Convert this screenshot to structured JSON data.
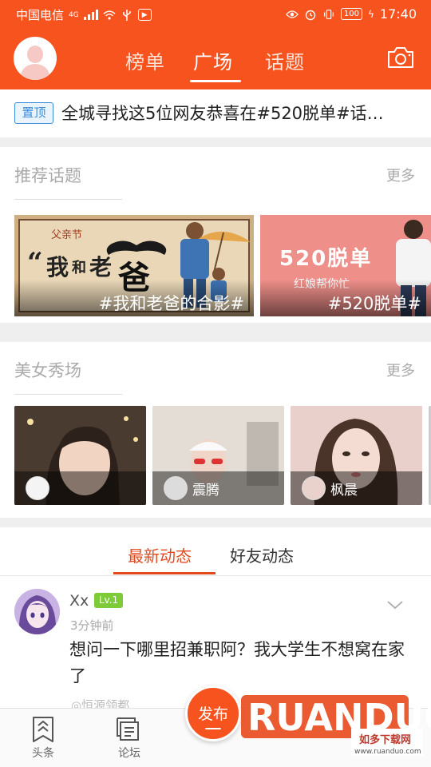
{
  "status_bar": {
    "carrier": "中国电信",
    "network": "4G",
    "battery": "100",
    "time": "17:40"
  },
  "header": {
    "tabs": [
      {
        "label": "榜单"
      },
      {
        "label": "广场"
      },
      {
        "label": "话题"
      }
    ],
    "active_tab": "广场",
    "accent_color": "#f6531f"
  },
  "pinned": {
    "badge": "置顶",
    "text": "全城寻找这5位网友恭喜在#520脱单#话…"
  },
  "recommended_topics": {
    "title": "推荐话题",
    "more": "更多",
    "cards": [
      {
        "caption": "#我和老爸的合影#",
        "art_text_small": "父亲节",
        "art_quote": "“",
        "art_text_1": "我",
        "art_text_2": "和",
        "art_text_3": "老",
        "art_text_big": "爸"
      },
      {
        "caption": "#520脱单#",
        "art_title": "520脱单",
        "art_subtitle": "红娘帮你忙"
      }
    ]
  },
  "beauty_show": {
    "title": "美女秀场",
    "more": "更多",
    "cards": [
      {
        "name": ""
      },
      {
        "name": "震腾"
      },
      {
        "name": "枫晨"
      }
    ]
  },
  "feed": {
    "tabs": [
      {
        "label": "最新动态"
      },
      {
        "label": "好友动态"
      }
    ],
    "active_tab": "最新动态",
    "post": {
      "user": "Xx",
      "level": "Lv.1",
      "time": "3分钟前",
      "text": "想问一下哪里招兼职阿？我大学生不想窝在家了",
      "location": "恒源领都"
    }
  },
  "bottom_nav": {
    "items": [
      {
        "label": "头条",
        "icon": "headline-icon"
      },
      {
        "label": "论坛",
        "icon": "forum-icon"
      }
    ],
    "publish": "发布"
  },
  "watermark": {
    "brand": "RUANDUO",
    "cn": "如多下载网",
    "url": "www.ruanduo.com"
  }
}
